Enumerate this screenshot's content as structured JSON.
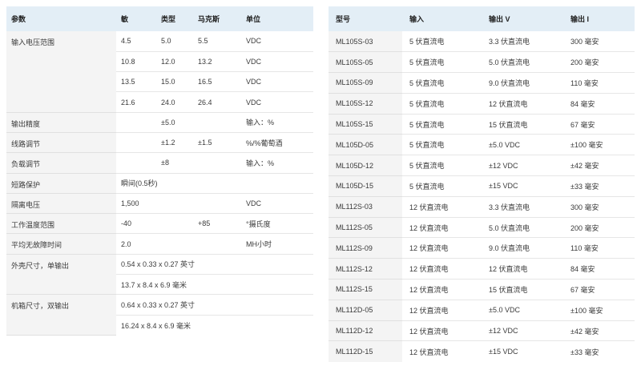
{
  "spec_table": {
    "headers": [
      "参数",
      "敏",
      "类型",
      "马克斯",
      "单位"
    ],
    "rows": [
      {
        "param": "输入电压范围",
        "min": "4.5",
        "typ": "5.0",
        "max": "5.5",
        "unit": "VDC"
      },
      {
        "param": "",
        "min": "10.8",
        "typ": "12.0",
        "max": "13.2",
        "unit": "VDC"
      },
      {
        "param": "",
        "min": "13.5",
        "typ": "15.0",
        "max": "16.5",
        "unit": "VDC"
      },
      {
        "param": "",
        "min": "21.6",
        "typ": "24.0",
        "max": "26.4",
        "unit": "VDC"
      },
      {
        "param": "输出精度",
        "min": "",
        "typ": "±5.0",
        "max": "",
        "unit": "输入：%"
      },
      {
        "param": "线路调节",
        "min": "",
        "typ": "±1.2",
        "max": "±1.5",
        "unit": "%/%葡萄酒"
      },
      {
        "param": "负载调节",
        "min": "",
        "typ": "±8",
        "max": "",
        "unit": "输入：%"
      },
      {
        "param": "短路保护",
        "span": "瞬间(0.5秒)"
      },
      {
        "param": "隔离电压",
        "min": "1,500",
        "typ": "",
        "max": "",
        "unit": "VDC"
      },
      {
        "param": "工作温度范围",
        "min": "-40",
        "typ": "",
        "max": "+85",
        "unit": "°摄氏度"
      },
      {
        "param": "平均无故障时间",
        "min": "2.0",
        "typ": "",
        "max": "",
        "unit": "MH小时"
      },
      {
        "param": "外壳尺寸，单输出",
        "span": "0.54 x 0.33 x 0.27 英寸"
      },
      {
        "param": "",
        "span": "13.7 x 8.4 x 6.9 毫米"
      },
      {
        "param": "机箱尺寸，双输出",
        "span": "0.64 x 0.33 x 0.27 英寸"
      },
      {
        "param": "",
        "span": "16.24 x 8.4 x 6.9 毫米"
      }
    ]
  },
  "model_table": {
    "headers": [
      "型号",
      "输入",
      "输出 V",
      "输出 I"
    ],
    "rows": [
      [
        "ML105S-03",
        "5 伏直流电",
        "3.3 伏直流电",
        "300 毫安"
      ],
      [
        "ML105S-05",
        "5 伏直流电",
        "5.0 伏直流电",
        "200 毫安"
      ],
      [
        "ML105S-09",
        "5 伏直流电",
        "9.0 伏直流电",
        "110 毫安"
      ],
      [
        "ML105S-12",
        "5 伏直流电",
        "12 伏直流电",
        "84 毫安"
      ],
      [
        "ML105S-15",
        "5 伏直流电",
        "15 伏直流电",
        "67 毫安"
      ],
      [
        "ML105D-05",
        "5 伏直流电",
        "±5.0 VDC",
        "±100 毫安"
      ],
      [
        "ML105D-12",
        "5 伏直流电",
        "±12 VDC",
        "±42 毫安"
      ],
      [
        "ML105D-15",
        "5 伏直流电",
        "±15 VDC",
        "±33 毫安"
      ],
      [
        "ML112S-03",
        "12 伏直流电",
        "3.3 伏直流电",
        "300 毫安"
      ],
      [
        "ML112S-05",
        "12 伏直流电",
        "5.0 伏直流电",
        "200 毫安"
      ],
      [
        "ML112S-09",
        "12 伏直流电",
        "9.0 伏直流电",
        "110 毫安"
      ],
      [
        "ML112S-12",
        "12 伏直流电",
        "12 伏直流电",
        "84 毫安"
      ],
      [
        "ML112S-15",
        "12 伏直流电",
        "15 伏直流电",
        "67 毫安"
      ],
      [
        "ML112D-05",
        "12 伏直流电",
        "±5.0 VDC",
        "±100 毫安"
      ],
      [
        "ML112D-12",
        "12 伏直流电",
        "±12 VDC",
        "±42 毫安"
      ],
      [
        "ML112D-15",
        "12 伏直流电",
        "±15 VDC",
        "±33 毫安"
      ]
    ]
  }
}
